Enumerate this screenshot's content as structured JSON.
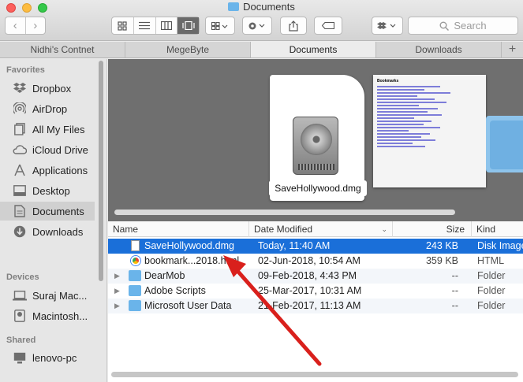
{
  "window": {
    "title": "Documents"
  },
  "toolbar": {
    "back_label": "‹",
    "forward_label": "›",
    "search_placeholder": "Search"
  },
  "tabs": [
    {
      "label": "Nidhi's Contnet",
      "active": false
    },
    {
      "label": "MegeByte",
      "active": false
    },
    {
      "label": "Documents",
      "active": true
    },
    {
      "label": "Downloads",
      "active": false
    }
  ],
  "tab_add_label": "+",
  "sidebar": {
    "favorites_title": "Favorites",
    "favorites": [
      {
        "label": "Dropbox",
        "icon": "dropbox-icon"
      },
      {
        "label": "AirDrop",
        "icon": "airdrop-icon"
      },
      {
        "label": "All My Files",
        "icon": "all-files-icon"
      },
      {
        "label": "iCloud Drive",
        "icon": "cloud-icon"
      },
      {
        "label": "Applications",
        "icon": "applications-icon"
      },
      {
        "label": "Desktop",
        "icon": "desktop-icon"
      },
      {
        "label": "Documents",
        "icon": "documents-icon",
        "selected": true
      },
      {
        "label": "Downloads",
        "icon": "downloads-icon"
      }
    ],
    "devices_title": "Devices",
    "devices": [
      {
        "label": "Suraj Mac...",
        "icon": "laptop-icon"
      },
      {
        "label": "Macintosh...",
        "icon": "disk-icon"
      }
    ],
    "shared_title": "Shared",
    "shared": [
      {
        "label": "lenovo-pc",
        "icon": "pc-icon"
      }
    ]
  },
  "preview": {
    "file_label": "SaveHollywood.dmg",
    "thumb_title": "Bookmarks"
  },
  "list": {
    "columns": {
      "name": "Name",
      "date": "Date Modified",
      "size": "Size",
      "kind": "Kind"
    },
    "rows": [
      {
        "name": "SaveHollywood.dmg",
        "date": "Today, 11:40 AM",
        "size": "243 KB",
        "kind": "Disk Image",
        "type": "file",
        "selected": true
      },
      {
        "name": "bookmark...2018.html",
        "date": "02-Jun-2018, 10:54 AM",
        "size": "359 KB",
        "kind": "HTML",
        "type": "html"
      },
      {
        "name": "DearMob",
        "date": "09-Feb-2018, 4:43 PM",
        "size": "--",
        "kind": "Folder",
        "type": "folder"
      },
      {
        "name": "Adobe Scripts",
        "date": "25-Mar-2017, 10:31 AM",
        "size": "--",
        "kind": "Folder",
        "type": "folder"
      },
      {
        "name": "Microsoft User Data",
        "date": "21-Feb-2017, 11:13 AM",
        "size": "--",
        "kind": "Folder",
        "type": "folder"
      }
    ]
  },
  "colors": {
    "selection": "#1a6fd9",
    "annotation_arrow": "#d9201c"
  }
}
